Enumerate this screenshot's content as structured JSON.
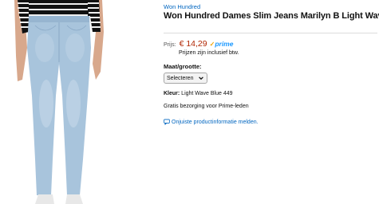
{
  "product": {
    "brand": "Won Hundred",
    "title": "Won Hundred Dames Slim Jeans Marilyn B Light Wave Blue",
    "price_label": "Prijs:",
    "price": "€ 14,29",
    "prime_label": "prime",
    "vat_note": "Prijzen zijn inclusief btw.",
    "size_label": "Maat/grootte:",
    "size_selected": "Selecteren",
    "color_label": "Kleur:",
    "color_value": "Light Wave Blue 449",
    "shipping_note": "Gratis bezorging voor Prime-leden",
    "report_link": "Onjuiste productinformatie melden."
  },
  "icons": {
    "prime_check": "check-icon",
    "dropdown": "chevron-down-icon",
    "report": "speech-bubble-icon",
    "product_image": "jeans-model-photo"
  },
  "colors": {
    "link": "#0066c0",
    "price": "#b12704",
    "prime_blue": "#1a98ff",
    "prime_check": "#f0a50a",
    "denim": "#a8c4dc"
  }
}
